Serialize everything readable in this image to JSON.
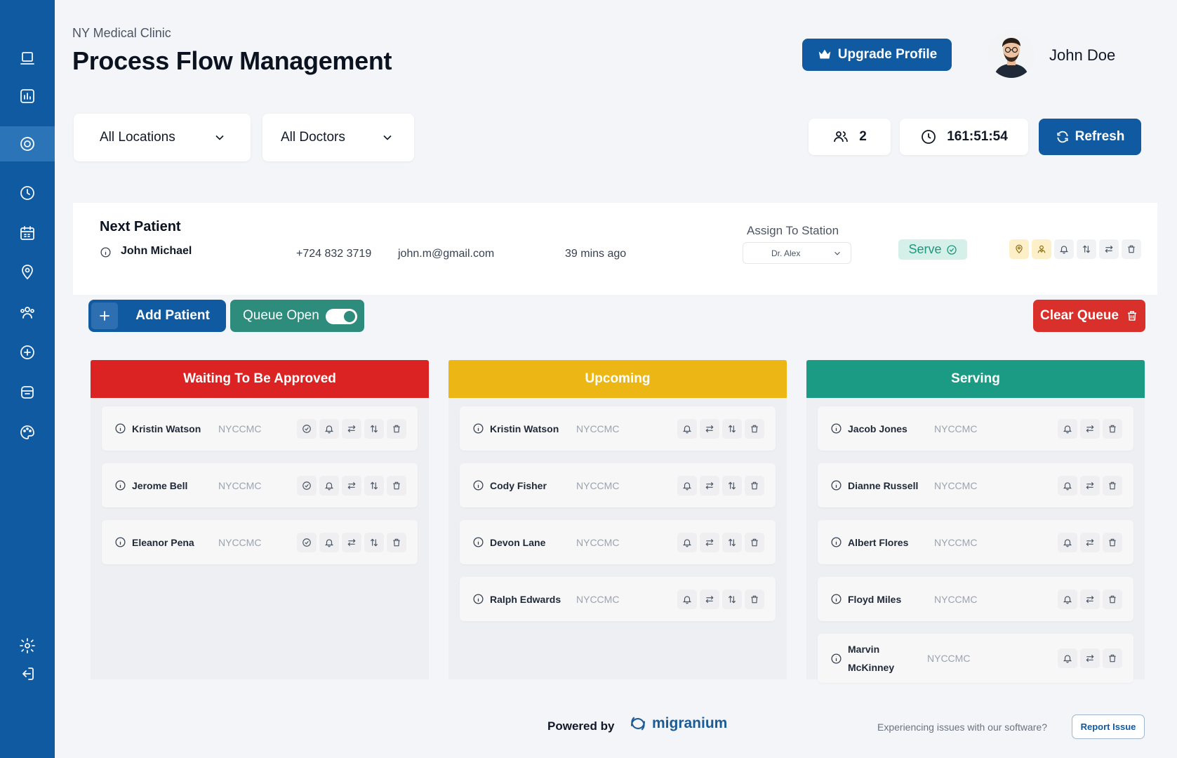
{
  "header": {
    "clinic_name": "NY Medical Clinic",
    "title": "Process Flow Management",
    "upgrade_label": "Upgrade Profile",
    "user_name": "John Doe"
  },
  "filters": {
    "location": "All Locations",
    "doctor": "All Doctors"
  },
  "stats": {
    "patient_count": "2",
    "timer": "161:51:54",
    "refresh_label": "Refresh"
  },
  "next_patient": {
    "heading": "Next Patient",
    "name": "John Michael",
    "phone": "+724 832 3719",
    "email": "john.m@gmail.com",
    "time_ago": "39 mins ago",
    "assign_label": "Assign To Station",
    "station": "Dr. Alex",
    "serve_label": "Serve"
  },
  "actions": {
    "add_patient": "Add Patient",
    "queue_open": "Queue Open",
    "queue_open_state": true,
    "clear_queue": "Clear Queue"
  },
  "columns": {
    "waiting": {
      "title": "Waiting To Be Approved",
      "color": "#dc2323",
      "patients": [
        {
          "name": "Kristin Watson",
          "code": "NYCCMC"
        },
        {
          "name": "Jerome Bell",
          "code": "NYCCMC"
        },
        {
          "name": "Eleanor Pena",
          "code": "NYCCMC"
        }
      ]
    },
    "upcoming": {
      "title": "Upcoming",
      "color": "#ecb614",
      "patients": [
        {
          "name": "Kristin Watson",
          "code": "NYCCMC"
        },
        {
          "name": "Cody Fisher",
          "code": "NYCCMC"
        },
        {
          "name": "Devon Lane",
          "code": "NYCCMC"
        },
        {
          "name": "Ralph Edwards",
          "code": "NYCCMC"
        }
      ]
    },
    "serving": {
      "title": "Serving",
      "color": "#1b9a84",
      "patients": [
        {
          "name": "Jacob Jones",
          "code": "NYCCMC"
        },
        {
          "name": "Dianne Russell",
          "code": "NYCCMC"
        },
        {
          "name": "Albert Flores",
          "code": "NYCCMC"
        },
        {
          "name": "Floyd Miles",
          "code": "NYCCMC"
        },
        {
          "name": "Marvin McKinney",
          "code": "NYCCMC"
        }
      ]
    }
  },
  "footer": {
    "powered_by": "Powered by",
    "brand": "migranium",
    "issue_text": "Experiencing issues with our software?",
    "report_label": "Report Issue"
  },
  "sidebar": {
    "icons": [
      "monitor-icon",
      "bar-chart-icon",
      "process-flow-icon",
      "clock-icon",
      "calendar-icon",
      "location-pin-icon",
      "users-icon",
      "plus-circle-icon",
      "archive-icon",
      "palette-icon",
      "gear-icon",
      "logout-icon"
    ],
    "active": "process-flow-icon"
  },
  "colors": {
    "sidebar": "#0f5aa0",
    "primary": "#0f5aa0",
    "danger": "#d9302c",
    "success": "#2e8c7c"
  }
}
